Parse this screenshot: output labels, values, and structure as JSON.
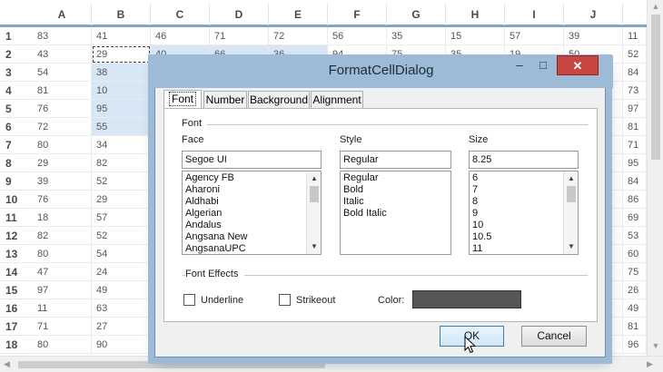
{
  "sheet": {
    "columns": [
      "A",
      "B",
      "C",
      "D",
      "E",
      "F",
      "G",
      "H",
      "I",
      "J"
    ],
    "rows": [
      {
        "n": "1",
        "v": [
          "83",
          "41",
          "46",
          "71",
          "72",
          "56",
          "35",
          "15",
          "57",
          "39",
          "11"
        ]
      },
      {
        "n": "2",
        "v": [
          "43",
          "29",
          "40",
          "66",
          "36",
          "94",
          "75",
          "35",
          "19",
          "50",
          "52"
        ]
      },
      {
        "n": "3",
        "v": [
          "54",
          "38",
          "",
          "",
          "",
          "",
          "",
          "",
          "",
          "",
          "84"
        ]
      },
      {
        "n": "4",
        "v": [
          "81",
          "10",
          "",
          "",
          "",
          "",
          "",
          "",
          "",
          "",
          "73"
        ]
      },
      {
        "n": "5",
        "v": [
          "76",
          "95",
          "",
          "",
          "",
          "",
          "",
          "",
          "",
          "",
          "97"
        ]
      },
      {
        "n": "6",
        "v": [
          "72",
          "55",
          "",
          "",
          "",
          "",
          "",
          "",
          "",
          "",
          "81"
        ]
      },
      {
        "n": "7",
        "v": [
          "80",
          "34",
          "",
          "",
          "",
          "",
          "",
          "",
          "",
          "",
          "71"
        ]
      },
      {
        "n": "8",
        "v": [
          "29",
          "82",
          "",
          "",
          "",
          "",
          "",
          "",
          "",
          "",
          "95"
        ]
      },
      {
        "n": "9",
        "v": [
          "39",
          "52",
          "",
          "",
          "",
          "",
          "",
          "",
          "",
          "",
          "84"
        ]
      },
      {
        "n": "10",
        "v": [
          "76",
          "29",
          "",
          "",
          "",
          "",
          "",
          "",
          "",
          "",
          "86"
        ]
      },
      {
        "n": "11",
        "v": [
          "18",
          "57",
          "",
          "",
          "",
          "",
          "",
          "",
          "",
          "",
          "69"
        ]
      },
      {
        "n": "12",
        "v": [
          "82",
          "52",
          "",
          "",
          "",
          "",
          "",
          "",
          "",
          "",
          "53"
        ]
      },
      {
        "n": "13",
        "v": [
          "80",
          "54",
          "",
          "",
          "",
          "",
          "",
          "",
          "",
          "",
          "60"
        ]
      },
      {
        "n": "14",
        "v": [
          "47",
          "24",
          "",
          "",
          "",
          "",
          "",
          "",
          "",
          "",
          "75"
        ]
      },
      {
        "n": "15",
        "v": [
          "97",
          "49",
          "",
          "",
          "",
          "",
          "",
          "",
          "",
          "",
          "26"
        ]
      },
      {
        "n": "16",
        "v": [
          "11",
          "63",
          "",
          "",
          "",
          "",
          "",
          "",
          "",
          "",
          "49"
        ]
      },
      {
        "n": "17",
        "v": [
          "71",
          "27",
          "",
          "",
          "",
          "",
          "",
          "",
          "",
          "",
          "81"
        ]
      },
      {
        "n": "18",
        "v": [
          "80",
          "90",
          "",
          "",
          "",
          "",
          "",
          "",
          "",
          "",
          "96"
        ]
      }
    ]
  },
  "dialog": {
    "title": "FormatCellDialog",
    "title_buttons": {
      "minimize": "–",
      "maximize": "□",
      "close": "✕"
    },
    "tabs": [
      "Font",
      "Number",
      "Background",
      "Alignment"
    ],
    "active_tab": "Font",
    "font_group": "Font",
    "face_label": "Face",
    "face_value": "Segoe UI",
    "face_list": [
      "Agency FB",
      "Aharoni",
      "Aldhabi",
      "Algerian",
      "Andalus",
      "Angsana New",
      "AngsanaUPC"
    ],
    "style_label": "Style",
    "style_value": "Regular",
    "style_list": [
      "Regular",
      "Bold",
      "Italic",
      "Bold Italic"
    ],
    "size_label": "Size",
    "size_value": "8.25",
    "size_list": [
      "6",
      "7",
      "8",
      "9",
      "10",
      "10.5",
      "11"
    ],
    "effects_group": "Font Effects",
    "underline_label": "Underline",
    "strikeout_label": "Strikeout",
    "color_label": "Color:",
    "color_value": "#565656",
    "ok_label": "OK",
    "cancel_label": "Cancel"
  },
  "colors": {
    "selection": "#d7e7f6",
    "header_band": "#7ea8c9",
    "title_bar": "#9dbbd6",
    "close": "#c7463f"
  }
}
